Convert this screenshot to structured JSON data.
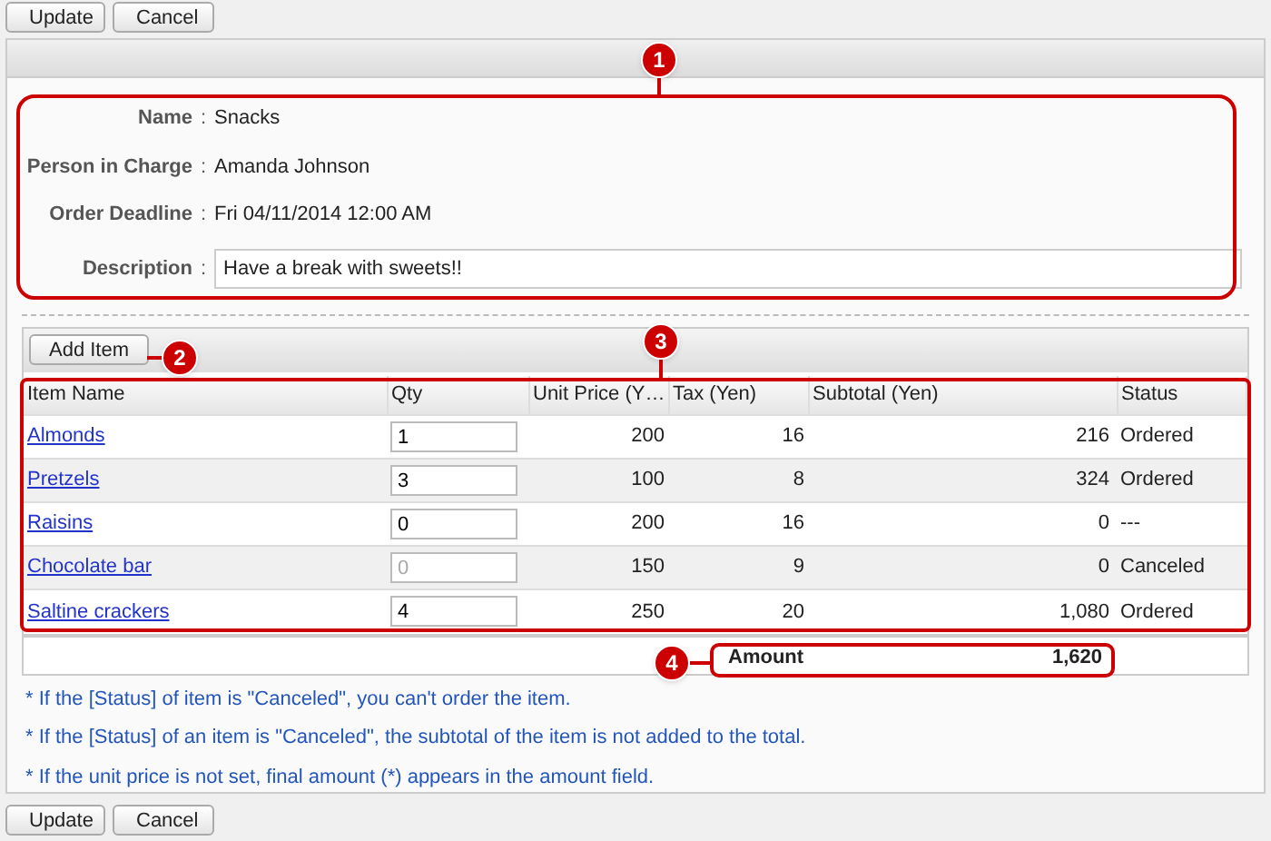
{
  "top_buttons": [
    "Update",
    "Cancel"
  ],
  "form": [
    {
      "label": "Name",
      "separator": ":",
      "value": "Snacks",
      "kind": "text"
    },
    {
      "label": "Person in Charge",
      "separator": ":",
      "value": "Amanda Johnson",
      "kind": "text"
    },
    {
      "label": "Order Deadline",
      "separator": ":",
      "value": "Fri 04/11/2014 12:00 AM",
      "kind": "text"
    },
    {
      "label": "Description",
      "separator": ":",
      "value": "Have a break with sweets!!",
      "kind": "box"
    }
  ],
  "add_item_button": "Add Item",
  "table": {
    "columns": [
      "Item Name",
      "Qty",
      "Unit Price (Y…",
      "Tax (Yen)",
      "Subtotal (Yen)",
      "Status"
    ],
    "rows": [
      {
        "name": "Almonds",
        "qty": "1",
        "qty_disabled": false,
        "unit_price": "200",
        "tax": "16",
        "subtotal": "216",
        "status": "Ordered"
      },
      {
        "name": "Pretzels",
        "qty": "3",
        "qty_disabled": false,
        "unit_price": "100",
        "tax": "8",
        "subtotal": "324",
        "status": "Ordered"
      },
      {
        "name": "Raisins",
        "qty": "0",
        "qty_disabled": false,
        "unit_price": "200",
        "tax": "16",
        "subtotal": "0",
        "status": "---"
      },
      {
        "name": "Chocolate bar",
        "qty": "0",
        "qty_disabled": true,
        "unit_price": "150",
        "tax": "9",
        "subtotal": "0",
        "status": "Canceled"
      },
      {
        "name": "Saltine crackers",
        "qty": "4",
        "qty_disabled": false,
        "unit_price": "250",
        "tax": "20",
        "subtotal": "1,080",
        "status": "Ordered"
      }
    ]
  },
  "amount": {
    "label": "Amount",
    "value": "1,620"
  },
  "notes": [
    "* If the [Status] of item is \"Canceled\", you can't order the item.",
    "* If the [Status] of an item is \"Canceled\", the subtotal of the item is not added to the total.",
    "* If the unit price is not set, final amount (*) appears in the amount field."
  ],
  "bottom_buttons": [
    "Update",
    "Cancel"
  ],
  "callouts": [
    "1",
    "2",
    "3",
    "4"
  ]
}
